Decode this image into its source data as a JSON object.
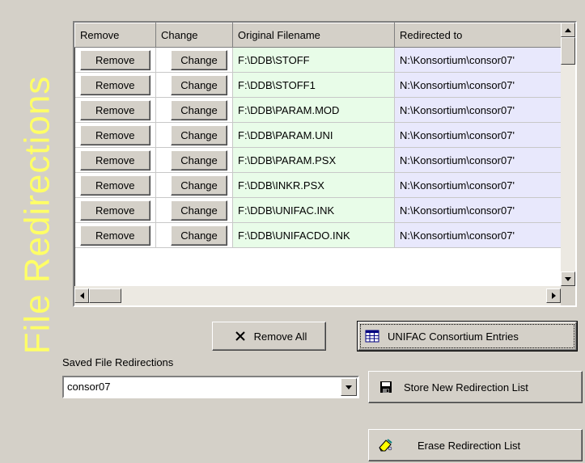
{
  "panel": {
    "title": "File Redirections",
    "title_color": "#ffff66"
  },
  "grid": {
    "columns": [
      "Remove",
      "Change",
      "Original Filename",
      "Redirected to"
    ],
    "row_button_labels": {
      "remove": "Remove",
      "change": "Change"
    },
    "rows": [
      {
        "original": "F:\\DDB\\STOFF",
        "redirected": "N:\\Konsortium\\consor07'"
      },
      {
        "original": "F:\\DDB\\STOFF1",
        "redirected": "N:\\Konsortium\\consor07'"
      },
      {
        "original": "F:\\DDB\\PARAM.MOD",
        "redirected": "N:\\Konsortium\\consor07'"
      },
      {
        "original": "F:\\DDB\\PARAM.UNI",
        "redirected": "N:\\Konsortium\\consor07'"
      },
      {
        "original": "F:\\DDB\\PARAM.PSX",
        "redirected": "N:\\Konsortium\\consor07'"
      },
      {
        "original": "F:\\DDB\\INKR.PSX",
        "redirected": "N:\\Konsortium\\consor07'"
      },
      {
        "original": "F:\\DDB\\UNIFAC.INK",
        "redirected": "N:\\Konsortium\\consor07'"
      },
      {
        "original": "F:\\DDB\\UNIFACDO.INK",
        "redirected": "N:\\Konsortium\\consor07'"
      }
    ],
    "colors": {
      "original_bg": "#e8fce8",
      "redirected_bg": "#e8e8fc"
    }
  },
  "actions": {
    "remove_all": {
      "label": "Remove All",
      "icon": "x-icon"
    },
    "consortium": {
      "label": "UNIFAC Consortium Entries",
      "icon": "table-icon"
    }
  },
  "saved": {
    "label": "Saved File Redirections",
    "selected": "consor07",
    "store_label": "Store New Redirection List",
    "store_icon": "floppy-disk-icon",
    "erase_label": "Erase Redirection List",
    "erase_icon": "eraser-icon"
  }
}
